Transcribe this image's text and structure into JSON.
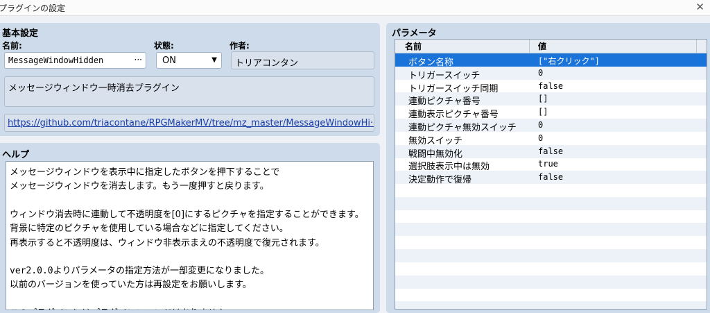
{
  "window": {
    "title": "プラグインの設定",
    "close_icon": "close-icon"
  },
  "basic": {
    "title": "基本設定",
    "name_label": "名前:",
    "name_value": "MessageWindowHidden",
    "name_button": "···",
    "status_label": "状態:",
    "status_value": "ON",
    "status_arrow": "▼",
    "author_label": "作者:",
    "author_value": "トリアコンタン",
    "description": "メッセージウィンドウ一時消去プラグイン",
    "url": "https://github.com/triacontane/RPGMakerMV/tree/mz_master/MessageWindowHi···"
  },
  "help": {
    "title": "ヘルプ",
    "lines": [
      "メッセージウィンドウを表示中に指定したボタンを押下することで",
      "メッセージウィンドウを消去します。もう一度押すと戻ります。",
      "",
      "ウィンドウ消去時に連動して不透明度を[0]にするピクチャを指定することができます。",
      "背景に特定のピクチャを使用している場合などに指定してください。",
      "再表示すると不透明度は、ウィンドウ非表示まえの不透明度で復元されます。",
      "",
      "ver2.0.0よりパラメータの指定方法が一部変更になりました。",
      "以前のバージョンを使っていた方は再設定をお願いします。",
      "",
      "このプラグインにはプラグインコマンドはありません。"
    ]
  },
  "params": {
    "title": "パラメータ",
    "col_name": "名前",
    "col_value": "値",
    "rows": [
      {
        "name": "ボタン名称",
        "value": "[\"右クリック\"]"
      },
      {
        "name": "トリガースイッチ",
        "value": "0"
      },
      {
        "name": "トリガースイッチ同期",
        "value": "false"
      },
      {
        "name": "連動ピクチャ番号",
        "value": "[]"
      },
      {
        "name": "連動表示ピクチャ番号",
        "value": "[]"
      },
      {
        "name": "連動ピクチャ無効スイッチ",
        "value": "0"
      },
      {
        "name": "無効スイッチ",
        "value": "0"
      },
      {
        "name": "戦闘中無効化",
        "value": "false"
      },
      {
        "name": "選択肢表示中は無効",
        "value": "true"
      },
      {
        "name": "決定動作で復帰",
        "value": "false"
      }
    ],
    "selected_index": 0
  },
  "colors": {
    "selection": "#1a73d9",
    "panel": "#cddbea",
    "link": "#1a3ea8"
  }
}
